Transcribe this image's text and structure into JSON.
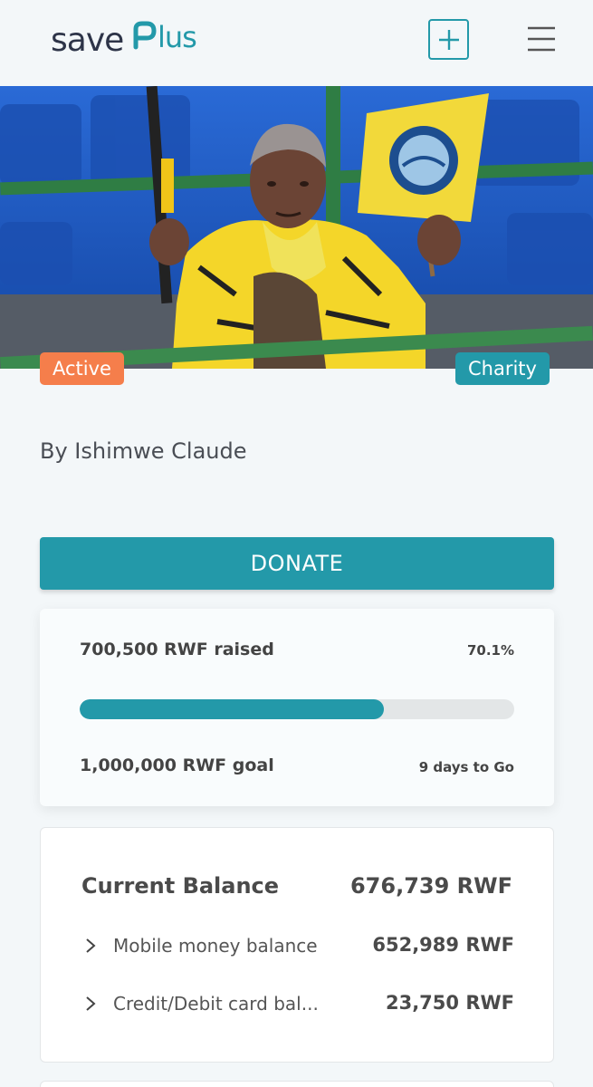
{
  "brand": {
    "logo_save": "save",
    "logo_plus": "Plus",
    "accent": "#2399a9",
    "orange": "#f57e4b"
  },
  "header": {
    "add_icon": "plus-icon",
    "menu_icon": "hamburger-menu-icon"
  },
  "campaign": {
    "status_badge": "Active",
    "category_badge": "Charity",
    "author": "By Ishimwe Claude",
    "donate_label": "DONATE"
  },
  "progress": {
    "raised": "700,500 RWF raised",
    "percent": "70.1%",
    "fraction": 0.701,
    "goal": "1,000,000 RWF goal",
    "days_left": "9 days to Go"
  },
  "balance": {
    "title": "Current Balance",
    "total": "676,739 RWF",
    "rows": [
      {
        "label": "Mobile money balance",
        "amount": "652,989 RWF"
      },
      {
        "label": "Credit/Debit card bal...",
        "amount": "23,750 RWF"
      }
    ]
  }
}
